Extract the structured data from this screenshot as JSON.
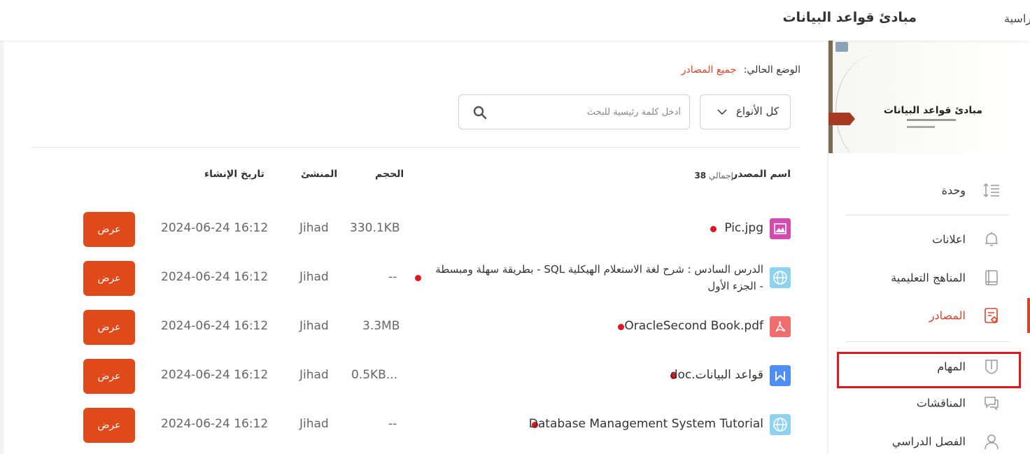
{
  "header": {
    "breadcrumb_tail": "راسية",
    "course_title": "مبادئ قواعد البيانات"
  },
  "cover": {
    "title": "مبادئ قواعد البيانات"
  },
  "sidebar": {
    "items": [
      {
        "label": "وحدة",
        "icon": "list-order-icon",
        "active": false
      },
      {
        "label": "اعلانات",
        "icon": "bell-icon",
        "active": false
      },
      {
        "label": "المناهج التعليمية",
        "icon": "book-icon",
        "active": false
      },
      {
        "label": "المصادر",
        "icon": "resources-icon",
        "active": true
      },
      {
        "label": "المهام",
        "icon": "task-shield-icon",
        "active": false
      },
      {
        "label": "المناقشات",
        "icon": "chat-icon",
        "active": false
      },
      {
        "label": "الفصل الدراسي",
        "icon": "user-icon",
        "active": false
      }
    ]
  },
  "status": {
    "label": "الوضع الحالي:",
    "sep": ":",
    "value": "جميع المصادر"
  },
  "filter": {
    "type_label": "كل الأنواع",
    "search_placeholder": "أدخل كلمة رئيسية للبحث"
  },
  "table": {
    "headers": {
      "name": "اسم المصدر",
      "total_label": "إجمالي",
      "total_count": "38",
      "size": "الحجم",
      "creator": "المنشئ",
      "created": "تاريخ الإنشاء"
    },
    "view_label": "عرض",
    "rows": [
      {
        "name": "Pic.jpg",
        "type": "image",
        "size": "330.1KB",
        "creator": "Jihad",
        "date": "2024-06-24 16:12"
      },
      {
        "name": "الدرس السادس : شرح لغة الاستعلام الهيكلية SQL - بطريقة سهلة ومبسطة - الجزء الأول",
        "type": "link",
        "size": "--",
        "creator": "Jihad",
        "date": "2024-06-24 16:12"
      },
      {
        "name": "OracleSecond Book.pdf",
        "type": "pdf",
        "size": "3.3MB",
        "creator": "Jihad",
        "date": "2024-06-24 16:12"
      },
      {
        "name": "قواعد البيانات.doc",
        "type": "word",
        "size": "0.5KB...",
        "creator": "Jihad",
        "date": "2024-06-24 16:12"
      },
      {
        "name": "Database Management System Tutorial",
        "type": "link",
        "size": "--",
        "creator": "Jihad",
        "date": "2024-06-24 16:12"
      }
    ]
  },
  "colors": {
    "accent": "#d8452b",
    "button": "#e04a1b",
    "dot": "#e0161c",
    "image_icon": "#d44bb0",
    "link_icon": "#8fd1f0",
    "pdf_icon": "#f06e6e",
    "word_icon": "#4f8ef3",
    "highlight": "#e0191f"
  }
}
